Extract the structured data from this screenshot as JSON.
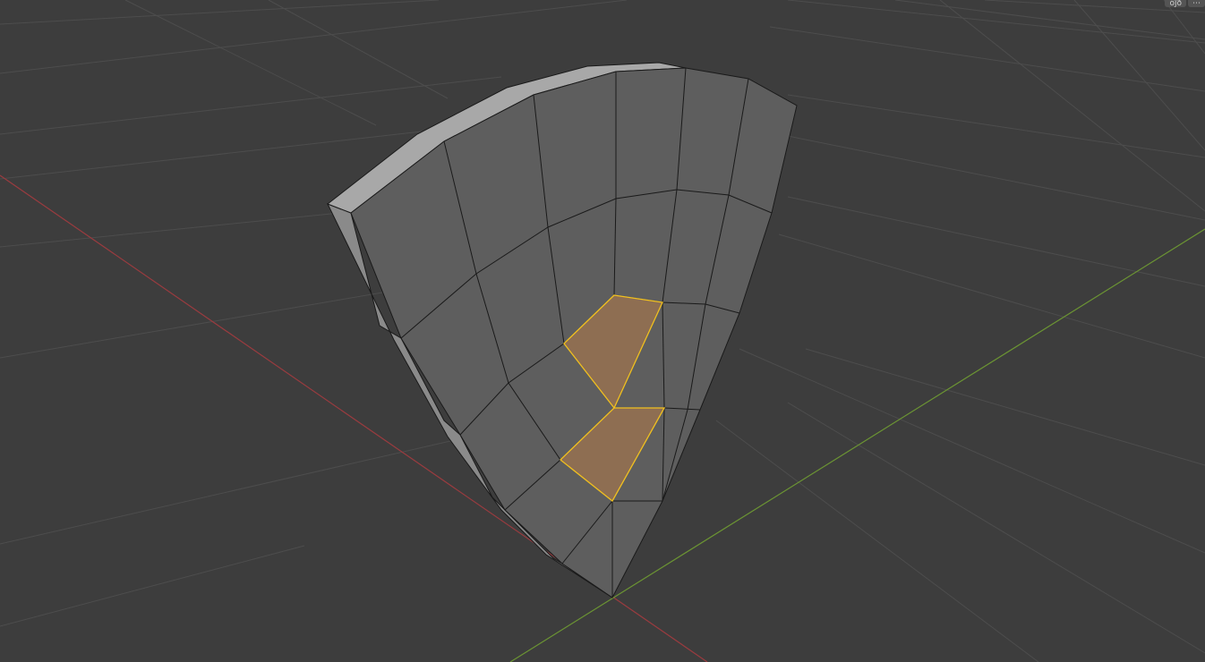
{
  "viewport": {
    "background": "#3d3d3d",
    "grid_color": "#4d4d4d",
    "x_axis_color": "#9a3b3f",
    "y_axis_color": "#6b9433",
    "mesh_face_color": "#5e5e5e",
    "mesh_top_color": "#a8a8a8",
    "mesh_edge_color": "#1a1a1a",
    "selected_face_color": "#8e6e52",
    "selected_edge_color": "#f0c020",
    "selected_face_count": 2
  },
  "corner_widget": {
    "left_label": "ôĵð",
    "right_label": "⋯"
  }
}
